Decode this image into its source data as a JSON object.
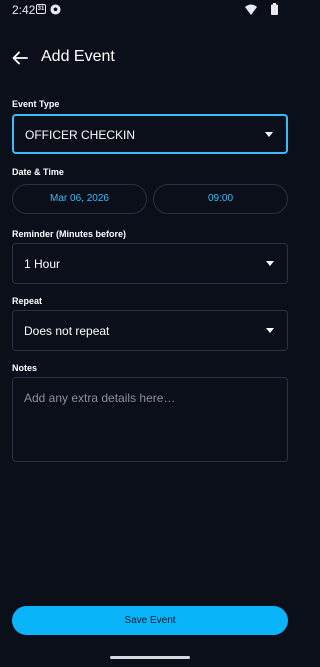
{
  "status_bar": {
    "time": "2:42",
    "calendar_day": "31",
    "icons": [
      "calendar-icon",
      "soccer-ball-icon",
      "wifi-icon",
      "battery-icon"
    ]
  },
  "header": {
    "title": "Add Event",
    "back_icon": "arrow-left-icon"
  },
  "event_type": {
    "label": "Event Type",
    "value": "OFFICER CHECKIN"
  },
  "date_time": {
    "label": "Date & Time",
    "date": "Mar 06, 2026",
    "time": "09:00"
  },
  "reminder": {
    "label": "Reminder (Minutes before)",
    "value": "1 Hour"
  },
  "repeat": {
    "label": "Repeat",
    "value": "Does not repeat"
  },
  "notes": {
    "label": "Notes",
    "placeholder": "Add any extra details here…",
    "value": ""
  },
  "save_button": {
    "label": "Save Event"
  },
  "colors": {
    "background": "#0b0f1a",
    "accent": "#38bdf8",
    "button": "#0ab4f8",
    "border": "#2a3142"
  }
}
